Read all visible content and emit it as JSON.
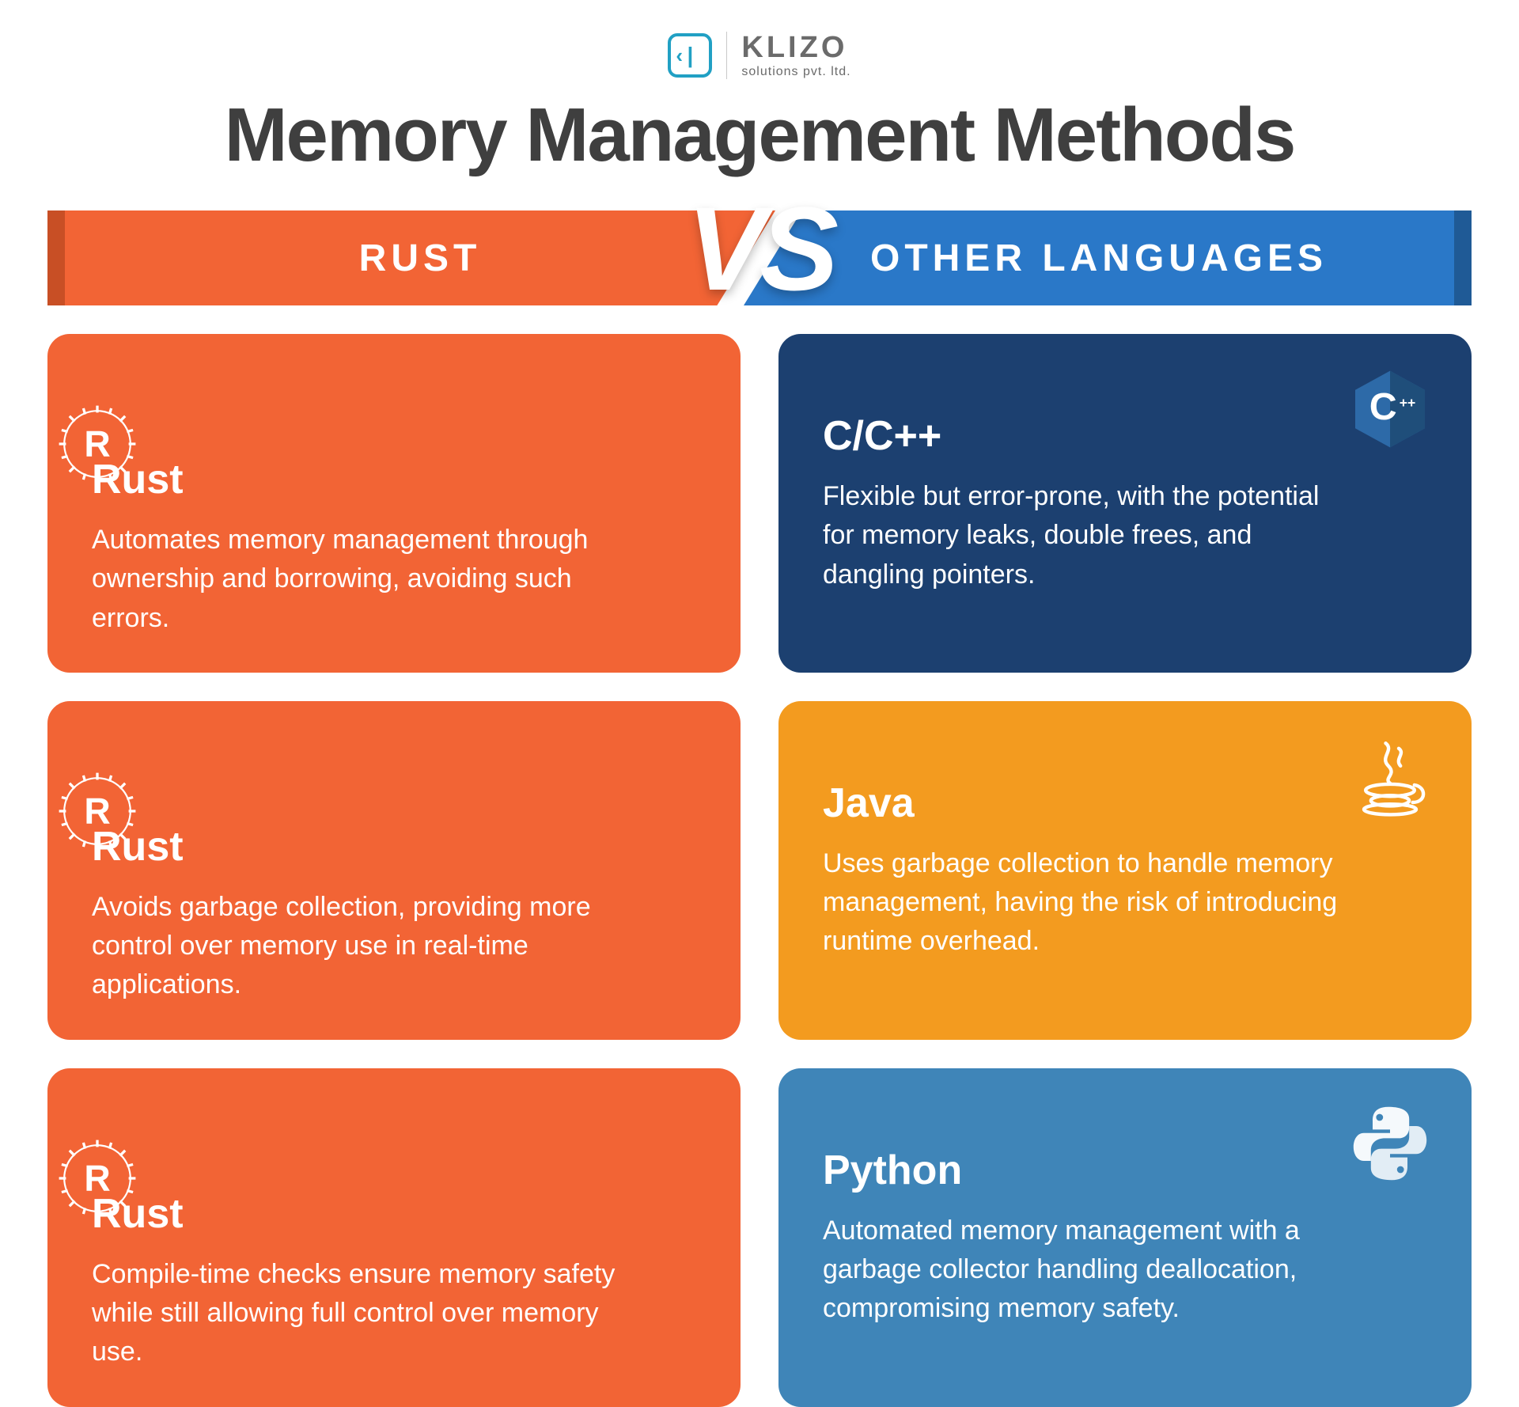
{
  "logo": {
    "name": "KLIZO",
    "sub": "solutions pvt. ltd."
  },
  "title": "Memory Management Methods",
  "vs": {
    "left": "RUST",
    "right": "OTHER LANGUAGES",
    "badge": "VS"
  },
  "cards": {
    "rust1": {
      "title": "Rust",
      "body": "Automates memory management through ownership and borrowing, avoiding such errors."
    },
    "ccpp": {
      "title": "C/C++",
      "body": "Flexible but error-prone, with the potential for memory leaks, double frees, and dangling pointers."
    },
    "rust2": {
      "title": "Rust",
      "body": "Avoids garbage collection, providing more control over memory use in real-time applications."
    },
    "java": {
      "title": "Java",
      "body": "Uses garbage collection to handle memory management, having the risk of introducing runtime overhead."
    },
    "rust3": {
      "title": "Rust",
      "body": "Compile-time checks ensure memory safety while still allowing full control over memory use."
    },
    "python": {
      "title": "Python",
      "body": "Automated memory management with a garbage collector handling deallocation, compromising memory safety."
    }
  }
}
